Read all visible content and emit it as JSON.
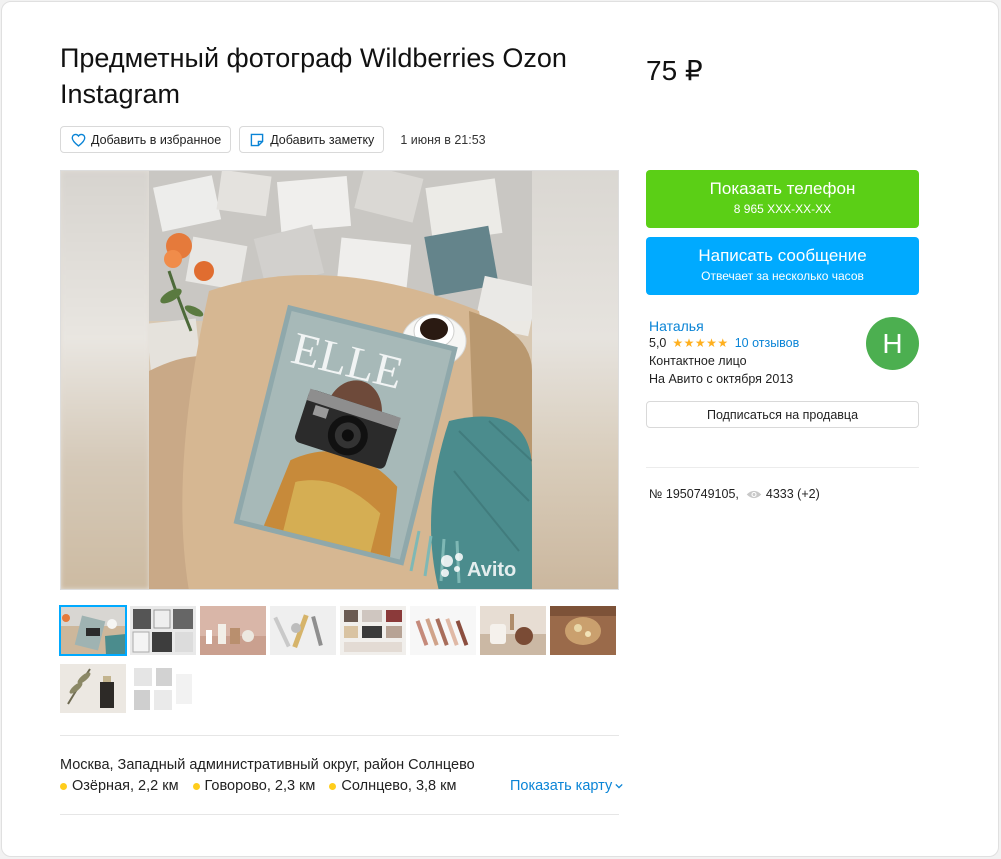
{
  "listing": {
    "title": "Предметный фотограф Wildberries Ozon Instagram",
    "price": "75 ₽",
    "date": "1 июня в 21:53"
  },
  "toolbar": {
    "favorite_label": "Добавить в избранное",
    "note_label": "Добавить заметку"
  },
  "photo": {
    "watermark": "Avito",
    "magazine_title": "ELLE"
  },
  "thumbnails_count": 10,
  "contact": {
    "phone_label": "Показать телефон",
    "phone_masked": "8 965 XXX-XX-XX",
    "message_label": "Написать сообщение",
    "message_sub": "Отвечает за несколько часов"
  },
  "seller": {
    "name": "Наталья",
    "rating": "5,0",
    "stars": "★★★★★",
    "reviews": "10 отзывов",
    "type": "Контактное лицо",
    "since": "На Авито с октября 2013",
    "avatar_letter": "Н",
    "avatar_color": "#4caf50",
    "subscribe_label": "Подписаться на продавца"
  },
  "meta": {
    "id": "№ 1950749105,",
    "views": "4333 (+2)"
  },
  "location": {
    "address": "Москва, Западный административный округ, район Солнцево",
    "metros": [
      {
        "name": "Озёрная, 2,2 км",
        "color": "#ffcd1c"
      },
      {
        "name": "Говорово, 2,3 км",
        "color": "#ffcd1c"
      },
      {
        "name": "Солнцево, 3,8 км",
        "color": "#ffcd1c"
      }
    ],
    "show_map": "Показать карту"
  },
  "colors": {
    "accent_blue": "#00aaff",
    "accent_green": "#5bcf16",
    "link": "#0a84d6"
  }
}
